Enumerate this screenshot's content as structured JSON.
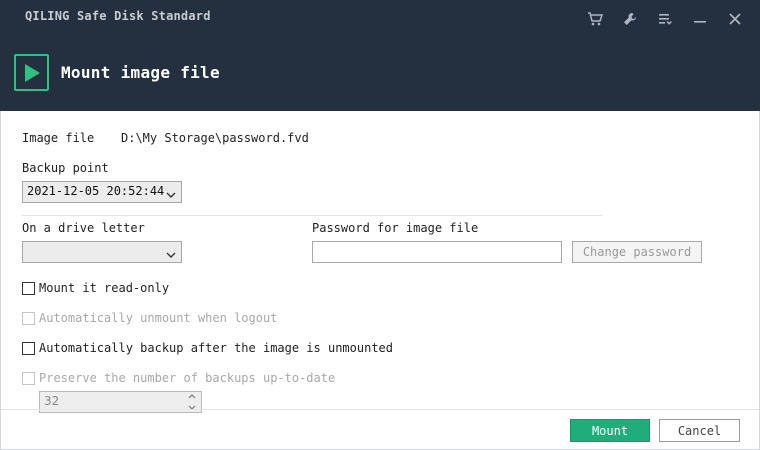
{
  "window": {
    "app_title": "QILING Safe Disk Standard",
    "controls": [
      {
        "name": "cart-icon"
      },
      {
        "name": "wrench-icon"
      },
      {
        "name": "menu-icon"
      },
      {
        "name": "minimize-icon"
      },
      {
        "name": "close-icon"
      }
    ]
  },
  "feature": {
    "title": "Mount image file",
    "icon": "play-icon",
    "accent": "#2ec27e"
  },
  "form": {
    "image_file_label": "Image file",
    "image_file_value": "D:\\My Storage\\password.fvd",
    "backup_point_label": "Backup point",
    "backup_point_value": "2021-12-05 20:52:44",
    "drive_letter_label": "On a drive letter",
    "drive_letter_value": "",
    "password_label": "Password for image file",
    "password_value": "",
    "change_password_label": "Change password",
    "options": {
      "read_only": {
        "label": "Mount it read-only",
        "checked": false,
        "enabled": true
      },
      "auto_unmount": {
        "label": "Automatically unmount when logout",
        "checked": false,
        "enabled": false
      },
      "auto_backup": {
        "label": "Automatically backup after the image is unmounted",
        "checked": false,
        "enabled": true
      },
      "preserve": {
        "label": "Preserve the number of backups up-to-date",
        "checked": false,
        "enabled": false
      }
    },
    "backups_count": "32"
  },
  "footer": {
    "mount_label": "Mount",
    "cancel_label": "Cancel",
    "primary_color": "#1fae7a"
  }
}
